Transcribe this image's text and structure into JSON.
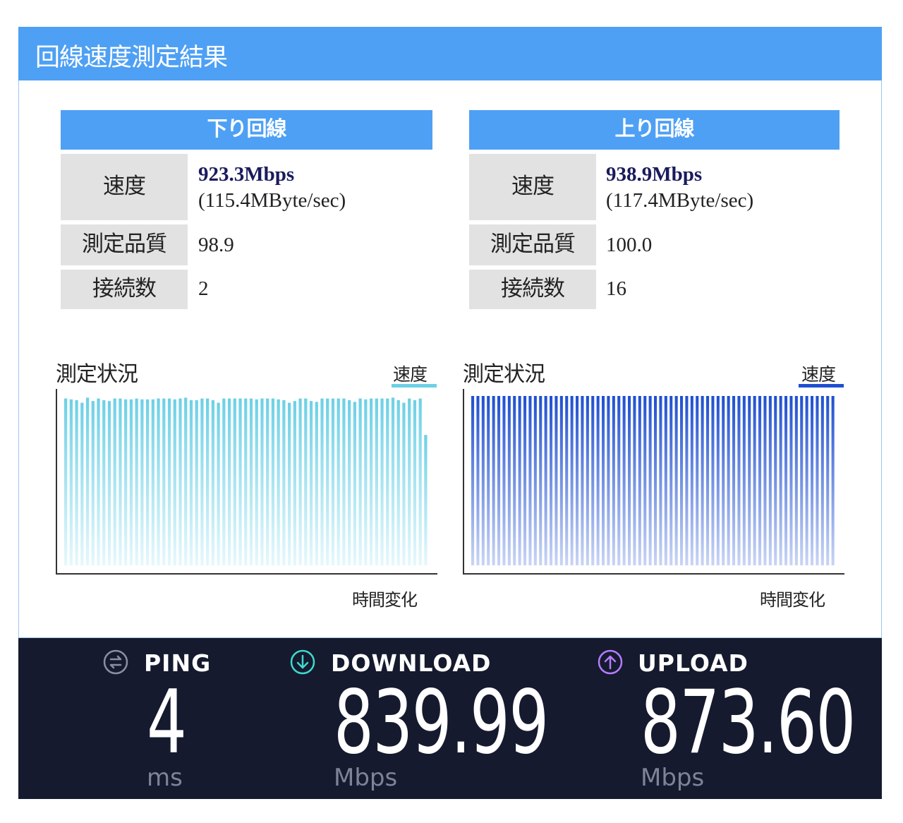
{
  "header": {
    "title": "回線速度測定結果"
  },
  "download": {
    "heading": "下り回線",
    "speed_label": "速度",
    "speed_value": "923.3Mbps",
    "speed_bytes": "(115.4MByte/sec)",
    "quality_label": "測定品質",
    "quality_value": "98.9",
    "connections_label": "接続数",
    "connections_value": "2"
  },
  "upload": {
    "heading": "上り回線",
    "speed_label": "速度",
    "speed_value": "938.9Mbps",
    "speed_bytes": "(117.4MByte/sec)",
    "quality_label": "測定品質",
    "quality_value": "100.0",
    "connections_label": "接続数",
    "connections_value": "16"
  },
  "chart_data": [
    {
      "type": "bar",
      "title": "測定状況",
      "legend": "速度",
      "xlabel": "時間変化",
      "legend_placement": "top-right",
      "color": "#6cd0e6",
      "ylim": [
        0,
        1.0
      ],
      "values": [
        0.985,
        0.98,
        0.975,
        0.96,
        0.99,
        0.97,
        0.985,
        0.975,
        0.97,
        0.985,
        0.985,
        0.98,
        0.98,
        0.985,
        0.98,
        0.98,
        0.98,
        0.985,
        0.985,
        0.985,
        0.98,
        0.985,
        0.99,
        0.975,
        0.975,
        0.985,
        0.985,
        0.975,
        0.96,
        0.985,
        0.985,
        0.985,
        0.985,
        0.985,
        0.985,
        0.98,
        0.985,
        0.985,
        0.985,
        0.98,
        0.975,
        0.96,
        0.97,
        0.985,
        0.985,
        0.97,
        0.965,
        0.985,
        0.985,
        0.985,
        0.985,
        0.985,
        0.975,
        0.965,
        0.985,
        0.98,
        0.985,
        0.985,
        0.985,
        0.985,
        0.99,
        0.975,
        0.96,
        0.985,
        0.975,
        0.985,
        0.77
      ]
    },
    {
      "type": "bar",
      "title": "測定状況",
      "legend": "速度",
      "xlabel": "時間変化",
      "legend_placement": "top-right",
      "color": "#1f4fd1",
      "ylim": [
        0,
        1.0
      ],
      "values": [
        1,
        1,
        1,
        1,
        1,
        1,
        1,
        1,
        1,
        1,
        1,
        1,
        1,
        1,
        1,
        1,
        1,
        1,
        1,
        1,
        1,
        1,
        1,
        1,
        1,
        1,
        1,
        1,
        1,
        1,
        1,
        1,
        1,
        1,
        1,
        1,
        1,
        1,
        1,
        1,
        1,
        1,
        1,
        1,
        1,
        1,
        1,
        1,
        1,
        1,
        1,
        1,
        1,
        1,
        1,
        1,
        1,
        1,
        1,
        1,
        1,
        1,
        1,
        1,
        1,
        1,
        1,
        1,
        1,
        1
      ]
    }
  ],
  "speedtest": {
    "ping_label": "PING",
    "ping_value": "4",
    "ping_unit": "ms",
    "download_label": "DOWNLOAD",
    "download_value": "839.99",
    "download_unit": "Mbps",
    "upload_label": "UPLOAD",
    "upload_value": "873.60",
    "upload_unit": "Mbps",
    "colors": {
      "ping": "#8a8fa0",
      "download": "#3fd8cc",
      "upload": "#b57cff"
    },
    "icons": {
      "ping": "ping-icon",
      "download": "download-arrow-icon",
      "upload": "upload-arrow-icon"
    }
  }
}
